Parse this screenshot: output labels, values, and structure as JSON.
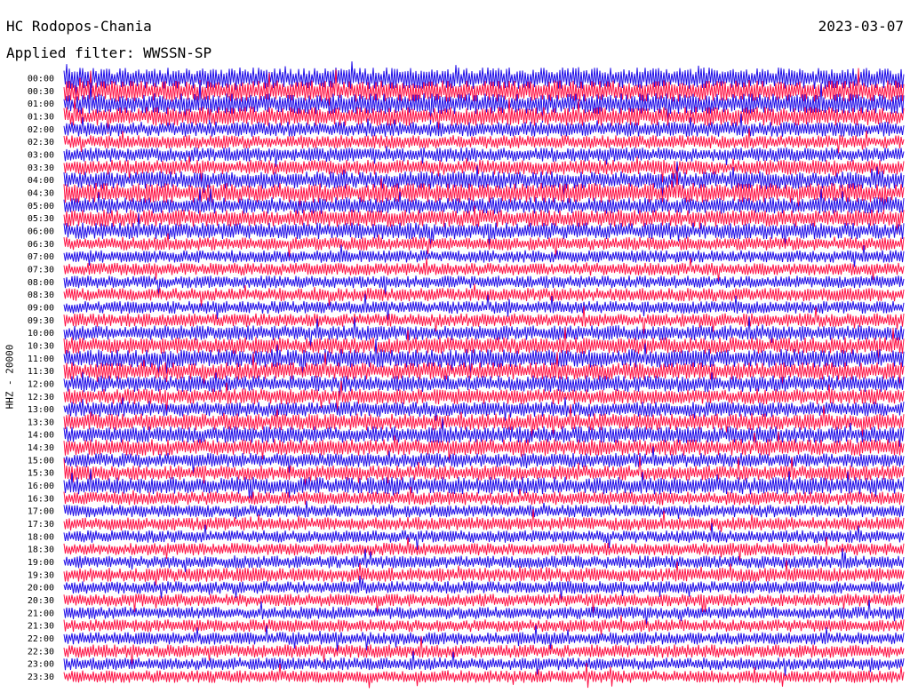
{
  "header": {
    "station": "HC Rodopos-Chania",
    "date": "2023-03-07",
    "filter": "Applied filter: WWSSN-SP"
  },
  "channel_label": "HHZ - 20000",
  "colors": {
    "trace_a": "#1f0de8",
    "trace_b": "#ff1245",
    "text": "#000000",
    "background": "#ffffff"
  },
  "chart_data": {
    "type": "line",
    "subtype": "helicorder",
    "rows": [
      {
        "label": "00:00",
        "color": "#1f0de8",
        "activity": 1.0
      },
      {
        "label": "00:30",
        "color": "#ff1245",
        "activity": 1.0
      },
      {
        "label": "01:00",
        "color": "#1f0de8",
        "activity": 0.95
      },
      {
        "label": "01:30",
        "color": "#ff1245",
        "activity": 0.85
      },
      {
        "label": "02:00",
        "color": "#1f0de8",
        "activity": 0.6
      },
      {
        "label": "02:30",
        "color": "#ff1245",
        "activity": 0.5
      },
      {
        "label": "03:00",
        "color": "#1f0de8",
        "activity": 0.55
      },
      {
        "label": "03:30",
        "color": "#ff1245",
        "activity": 0.6
      },
      {
        "label": "04:00",
        "color": "#1f0de8",
        "activity": 0.75
      },
      {
        "label": "04:30",
        "color": "#ff1245",
        "activity": 0.9
      },
      {
        "label": "05:00",
        "color": "#1f0de8",
        "activity": 0.7
      },
      {
        "label": "05:30",
        "color": "#ff1245",
        "activity": 0.75
      },
      {
        "label": "06:00",
        "color": "#1f0de8",
        "activity": 0.7
      },
      {
        "label": "06:30",
        "color": "#ff1245",
        "activity": 0.5
      },
      {
        "label": "07:00",
        "color": "#1f0de8",
        "activity": 0.45
      },
      {
        "label": "07:30",
        "color": "#ff1245",
        "activity": 0.45
      },
      {
        "label": "08:00",
        "color": "#1f0de8",
        "activity": 0.45
      },
      {
        "label": "08:30",
        "color": "#ff1245",
        "activity": 0.5
      },
      {
        "label": "09:00",
        "color": "#1f0de8",
        "activity": 0.45
      },
      {
        "label": "09:30",
        "color": "#ff1245",
        "activity": 0.5
      },
      {
        "label": "10:00",
        "color": "#1f0de8",
        "activity": 0.6
      },
      {
        "label": "10:30",
        "color": "#ff1245",
        "activity": 0.7
      },
      {
        "label": "11:00",
        "color": "#1f0de8",
        "activity": 0.8
      },
      {
        "label": "11:30",
        "color": "#ff1245",
        "activity": 0.75
      },
      {
        "label": "12:00",
        "color": "#1f0de8",
        "activity": 0.7
      },
      {
        "label": "12:30",
        "color": "#ff1245",
        "activity": 0.65
      },
      {
        "label": "13:00",
        "color": "#1f0de8",
        "activity": 0.6
      },
      {
        "label": "13:30",
        "color": "#ff1245",
        "activity": 0.7
      },
      {
        "label": "14:00",
        "color": "#1f0de8",
        "activity": 0.7
      },
      {
        "label": "14:30",
        "color": "#ff1245",
        "activity": 0.7
      },
      {
        "label": "15:00",
        "color": "#1f0de8",
        "activity": 0.55
      },
      {
        "label": "15:30",
        "color": "#ff1245",
        "activity": 0.6
      },
      {
        "label": "16:00",
        "color": "#1f0de8",
        "activity": 0.75
      },
      {
        "label": "16:30",
        "color": "#ff1245",
        "activity": 0.5
      },
      {
        "label": "17:00",
        "color": "#1f0de8",
        "activity": 0.45
      },
      {
        "label": "17:30",
        "color": "#ff1245",
        "activity": 0.5
      },
      {
        "label": "18:00",
        "color": "#1f0de8",
        "activity": 0.45
      },
      {
        "label": "18:30",
        "color": "#ff1245",
        "activity": 0.45
      },
      {
        "label": "19:00",
        "color": "#1f0de8",
        "activity": 0.45
      },
      {
        "label": "19:30",
        "color": "#ff1245",
        "activity": 0.55
      },
      {
        "label": "20:00",
        "color": "#1f0de8",
        "activity": 0.45
      },
      {
        "label": "20:30",
        "color": "#ff1245",
        "activity": 0.45
      },
      {
        "label": "21:00",
        "color": "#1f0de8",
        "activity": 0.45
      },
      {
        "label": "21:30",
        "color": "#ff1245",
        "activity": 0.45
      },
      {
        "label": "22:00",
        "color": "#1f0de8",
        "activity": 0.45
      },
      {
        "label": "22:30",
        "color": "#ff1245",
        "activity": 0.5
      },
      {
        "label": "23:00",
        "color": "#1f0de8",
        "activity": 0.45
      },
      {
        "label": "23:30",
        "color": "#ff1245",
        "activity": 0.45
      }
    ],
    "grid": false,
    "legend": "none"
  }
}
